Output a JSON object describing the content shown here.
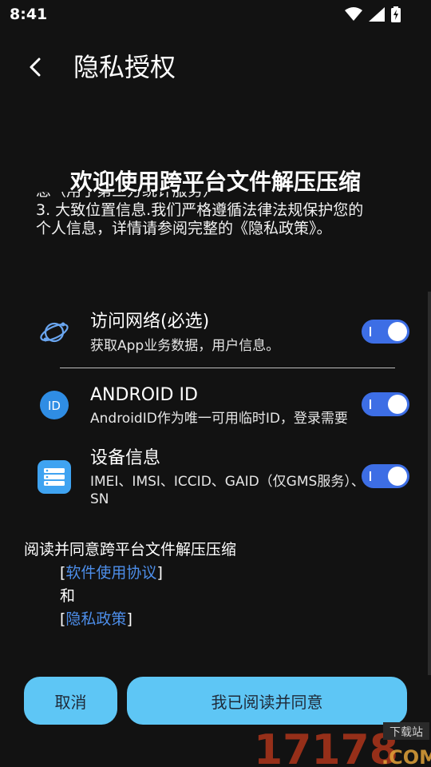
{
  "status_bar": {
    "time": "8:41"
  },
  "app_bar": {
    "title": "隐私授权"
  },
  "dialog": {
    "title": "欢迎使用跨平台文件解压压缩",
    "policy_lines": [
      "息（用于第三方统计服务）",
      "3. 大致位置信息.我们严格遵循法律法规保护您的",
      "个人信息，详情请参阅完整的《隐私政策》。"
    ]
  },
  "permissions": [
    {
      "icon": "network-globe-icon",
      "title": "访问网络(必选)",
      "desc": "获取App业务数据，用户信息。",
      "enabled": true
    },
    {
      "icon": "id-badge-icon",
      "title": "ANDROID ID",
      "desc": "AndroidID作为唯一可用临时ID，登录需要",
      "enabled": true
    },
    {
      "icon": "device-info-icon",
      "title": "设备信息",
      "desc": "IMEI、IMSI、ICCID、GAID（仅GMS服务）、OAID、",
      "desc2": "SN",
      "enabled": true
    }
  ],
  "consent": {
    "lead": "阅读并同意跨平台文件解压压缩",
    "link1": "软件使用协议",
    "and": "和",
    "link2": "隐私政策",
    "open_bracket": "[",
    "close_bracket": "]"
  },
  "buttons": {
    "cancel": "取消",
    "agree": "我已阅读并同意"
  },
  "watermark": {
    "number": "17178",
    "suffix": ".COM",
    "tag": "下载站"
  },
  "colors": {
    "accent": "#3d6ee5",
    "button": "#5ec6f5",
    "link": "#4d8eea",
    "background": "#121212"
  }
}
